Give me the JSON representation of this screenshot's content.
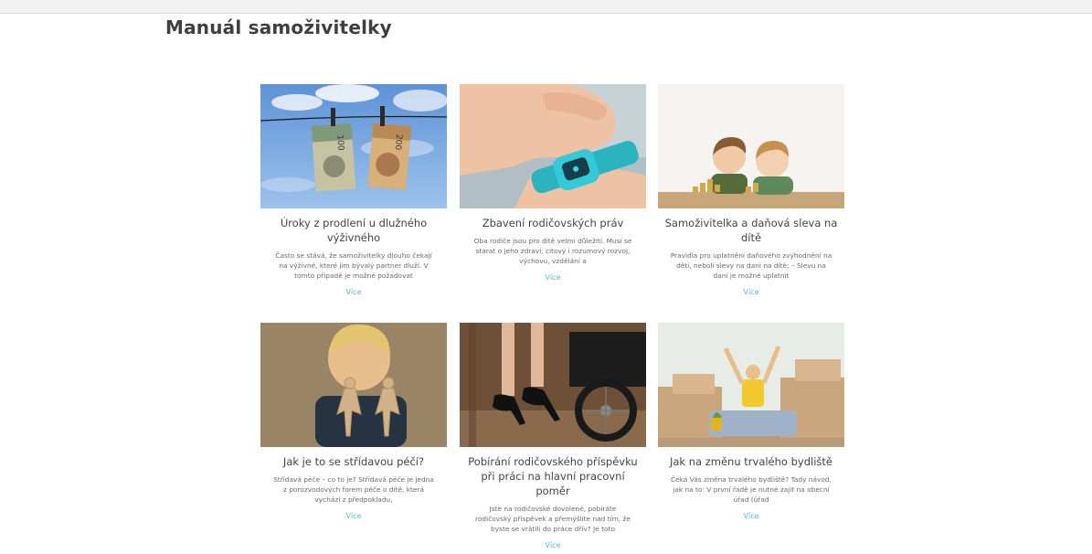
{
  "page": {
    "title": "Manuál samoživitelky"
  },
  "more_label": "Více",
  "articles": [
    {
      "title": "Úroky z prodlení u dlužného výživného",
      "excerpt": "Často se stává, že samoživitelky dlouho čekají na výživné, které jim bývalý partner dluží. V tomto případě je možné požadovat",
      "image": "banknotes-on-clothesline",
      "banknote_labels": [
        "100",
        "200"
      ]
    },
    {
      "title": "Zbavení rodičovských práv",
      "excerpt": "Oba rodiče jsou pro dítě velmi důležití. Musí se starat o jeho zdraví, citový i rozumový rozvoj, výchovu, vzdělání a",
      "image": "child-smartwatch"
    },
    {
      "title": "Samoživitelka a daňová sleva na dítě",
      "excerpt": "Pravidla pro uplatnění daňového zvýhodnění na děti, neboli slevy na dani na dítě: – Slevu na dani je možné uplatnit",
      "image": "children-with-coins"
    },
    {
      "title": "Jak je to se střídavou péčí?",
      "excerpt": "Střídavá péče – co to je? Střídavá péče je jedna z porozvodových forem péče o dítě, která vychází z předpokladu,",
      "image": "boy-with-paper-family"
    },
    {
      "title": "Pobírání rodičovského příspěvku při práci na hlavní pracovní poměr",
      "excerpt": "Jste na rodičovské dovolené, pobíráte rodičovský příspěvek a přemýšlíte nad tím, že byste se vrátili do práce dřív? Je toto",
      "image": "heels-and-stroller"
    },
    {
      "title": "Jak na změnu trvalého bydliště",
      "excerpt": "Čeká Vás změna trvalého bydliště? Tady návod, jak na to: V první řadě je nutné zajít na obecní úřad (úřad",
      "image": "woman-among-moving-boxes"
    }
  ]
}
